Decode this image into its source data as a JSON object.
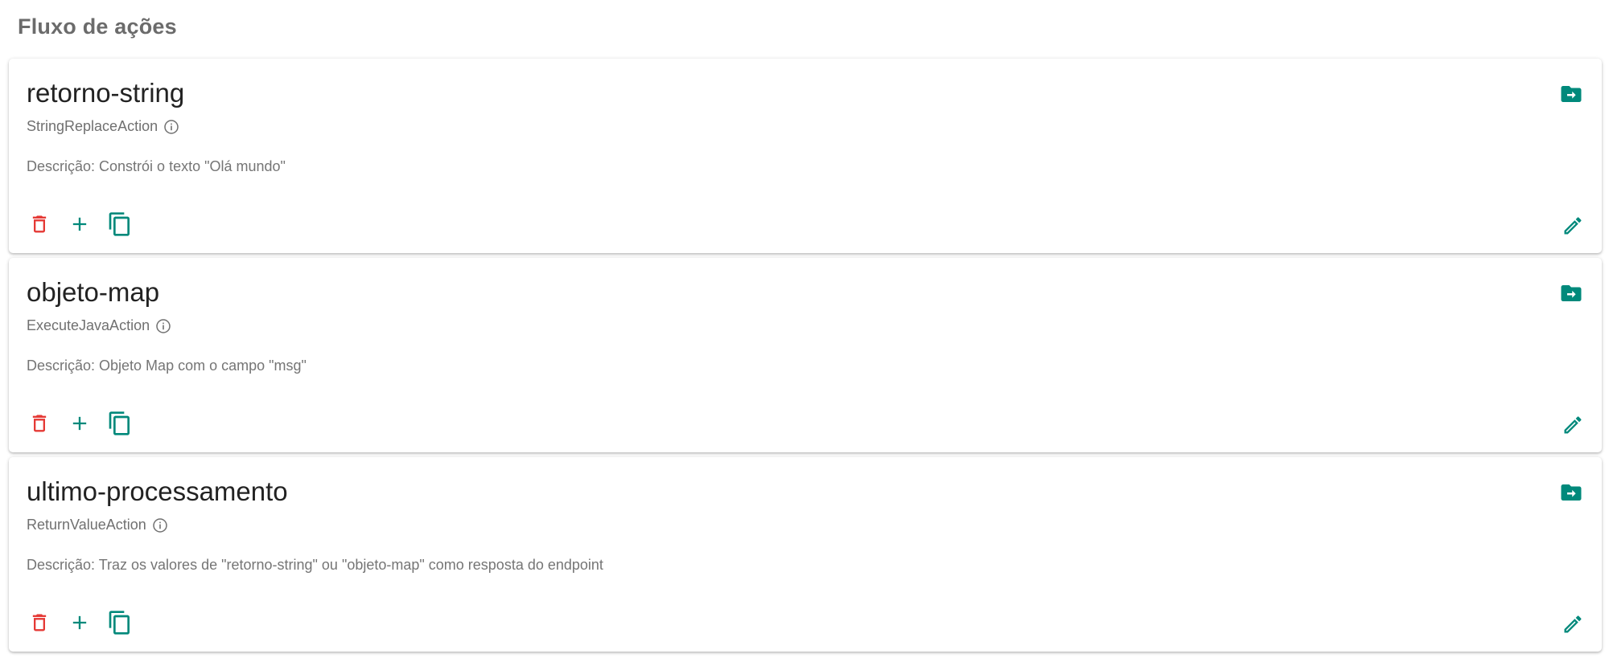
{
  "section": {
    "title": "Fluxo de ações"
  },
  "colors": {
    "delete": "#e53935",
    "accent": "#00897b"
  },
  "icons": {
    "info": "info-icon",
    "delete": "trash-icon",
    "add": "plus-icon",
    "copy": "copy-icon",
    "export": "folder-export-icon",
    "edit": "pencil-icon"
  },
  "cards": [
    {
      "title": "retorno-string",
      "type": "StringReplaceAction",
      "description": "Descrição: Constrói o texto \"Olá mundo\""
    },
    {
      "title": "objeto-map",
      "type": "ExecuteJavaAction",
      "description": "Descrição: Objeto Map com o campo \"msg\""
    },
    {
      "title": "ultimo-processamento",
      "type": "ReturnValueAction",
      "description": "Descrição: Traz os valores de \"retorno-string\" ou \"objeto-map\" como resposta do endpoint"
    }
  ]
}
